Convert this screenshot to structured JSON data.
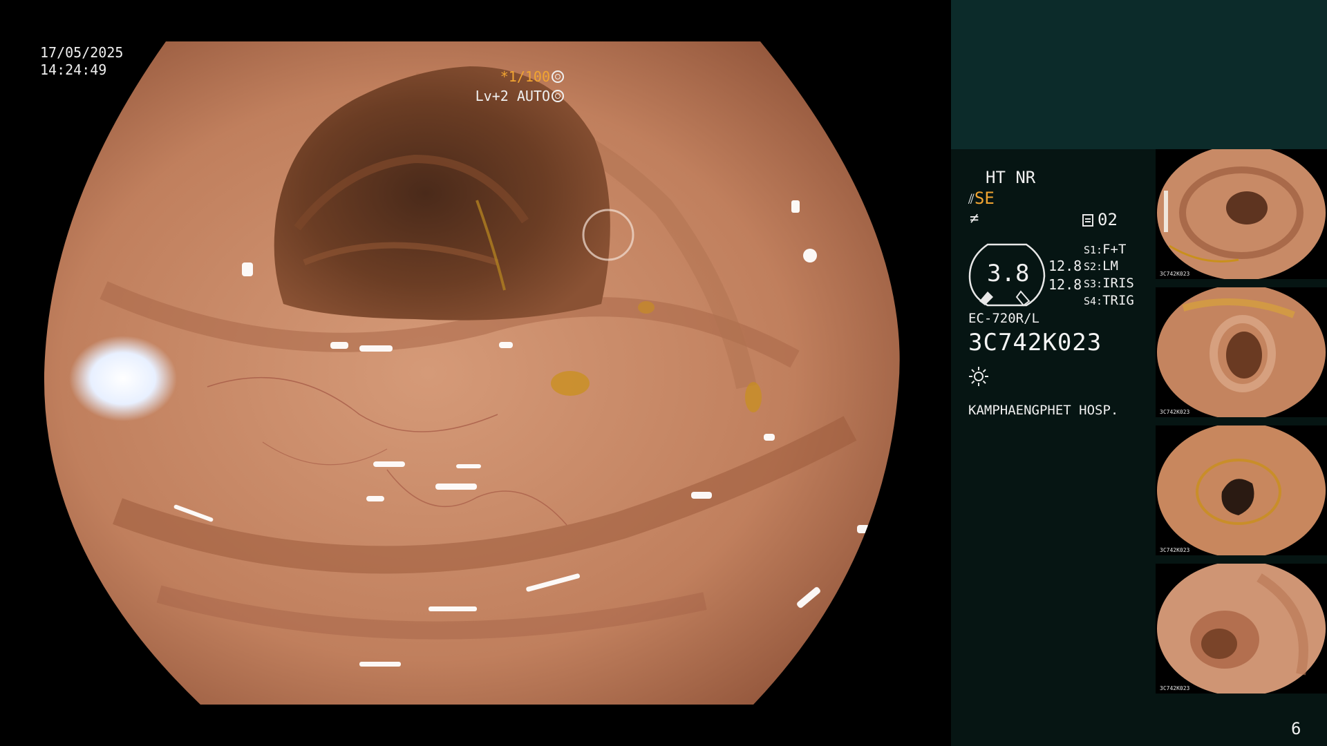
{
  "overlay": {
    "date": "17/05/2025",
    "time": "14:24:49",
    "shutter": "*1/100",
    "level": "Lv+2 AUTO"
  },
  "panel": {
    "ht_nr": "HT NR",
    "se": "SE",
    "mem": "02",
    "gauge_value": "3.8",
    "gauge_side_1": "12.8",
    "gauge_side_2": "12.8",
    "switches": [
      {
        "key": "S1:",
        "value": "F+T"
      },
      {
        "key": "S2:",
        "value": "LM"
      },
      {
        "key": "S3:",
        "value": "IRIS"
      },
      {
        "key": "S4:",
        "value": "TRIG"
      }
    ],
    "model": "EC-720R/L",
    "serial": "3C742K023",
    "hospital": "KAMPHAENGPHET HOSP."
  },
  "thumbnails": [
    {
      "serial": "3C742K023"
    },
    {
      "serial": "3C742K023"
    },
    {
      "serial": "3C742K023"
    },
    {
      "serial": "3C742K023"
    }
  ],
  "page_number": "6",
  "colors": {
    "accent_orange": "#f2a531",
    "panel_top": "#0c2b2a",
    "panel_dark": "#061513",
    "mucosa": "#c0805f"
  },
  "icons": [
    "shutter-icon",
    "auto-iris-icon",
    "scope-icon",
    "filter-icon",
    "memory-icon",
    "light-icon"
  ]
}
